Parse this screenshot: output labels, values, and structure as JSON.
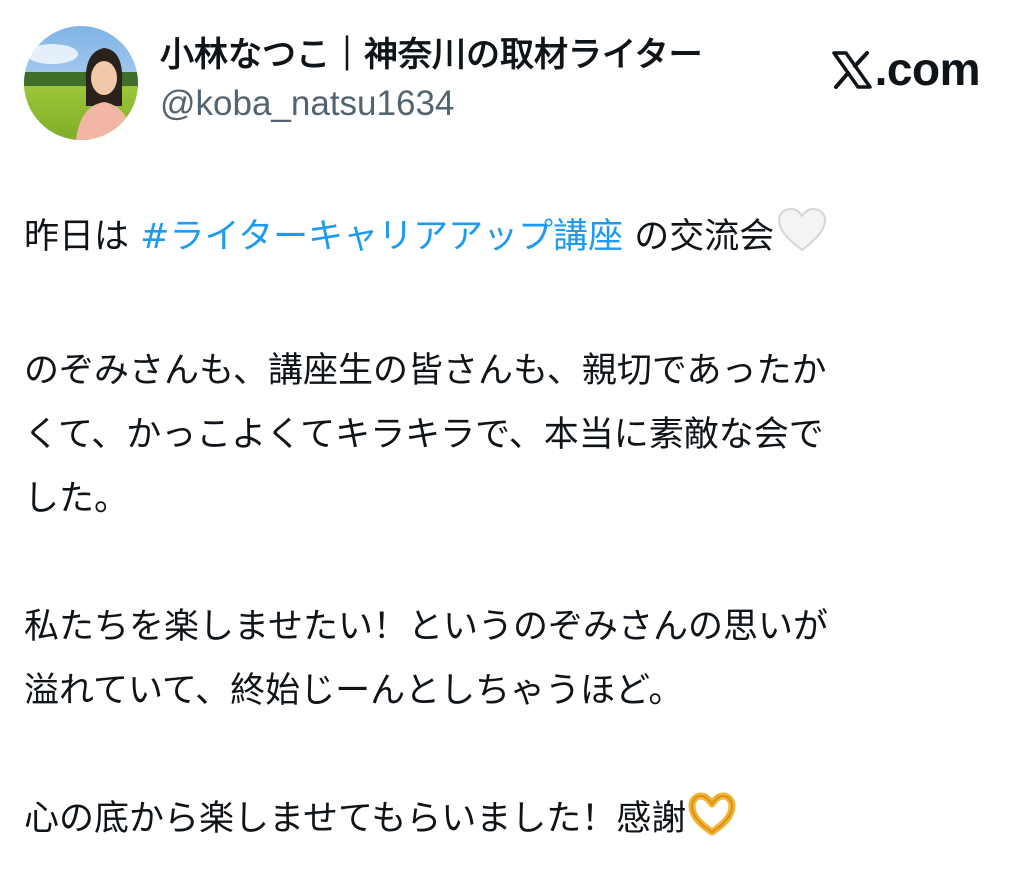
{
  "author": {
    "display_name": "小林なつこ｜神奈川の取材ライター",
    "handle": "@koba_natsu1634",
    "avatar_icon": "profile-photo-avatar"
  },
  "brand": {
    "label": ".com",
    "icon": "x-logo-icon"
  },
  "tweet": {
    "line1_prefix": "昨日は ",
    "hashtag": "#ライターキャリアアップ講座",
    "line1_suffix": " の交流会",
    "line1_emoji": "white-heart-icon",
    "paragraph2": "のぞみさんも、講座生の皆さんも、親切であったか\nくて、かっこよくてキラキラで、本当に素敵な会で\nした。",
    "paragraph3": "私たちを楽しませたい！というのぞみさんの思いが\n溢れていて、終始じーんとしちゃうほど。",
    "paragraph4": "心の底から楽しませてもらいました！感謝",
    "paragraph4_emoji": "heart-hands-icon"
  },
  "colors": {
    "text": "#0f1419",
    "secondary": "#536471",
    "hashtag": "#1d9bf0"
  }
}
